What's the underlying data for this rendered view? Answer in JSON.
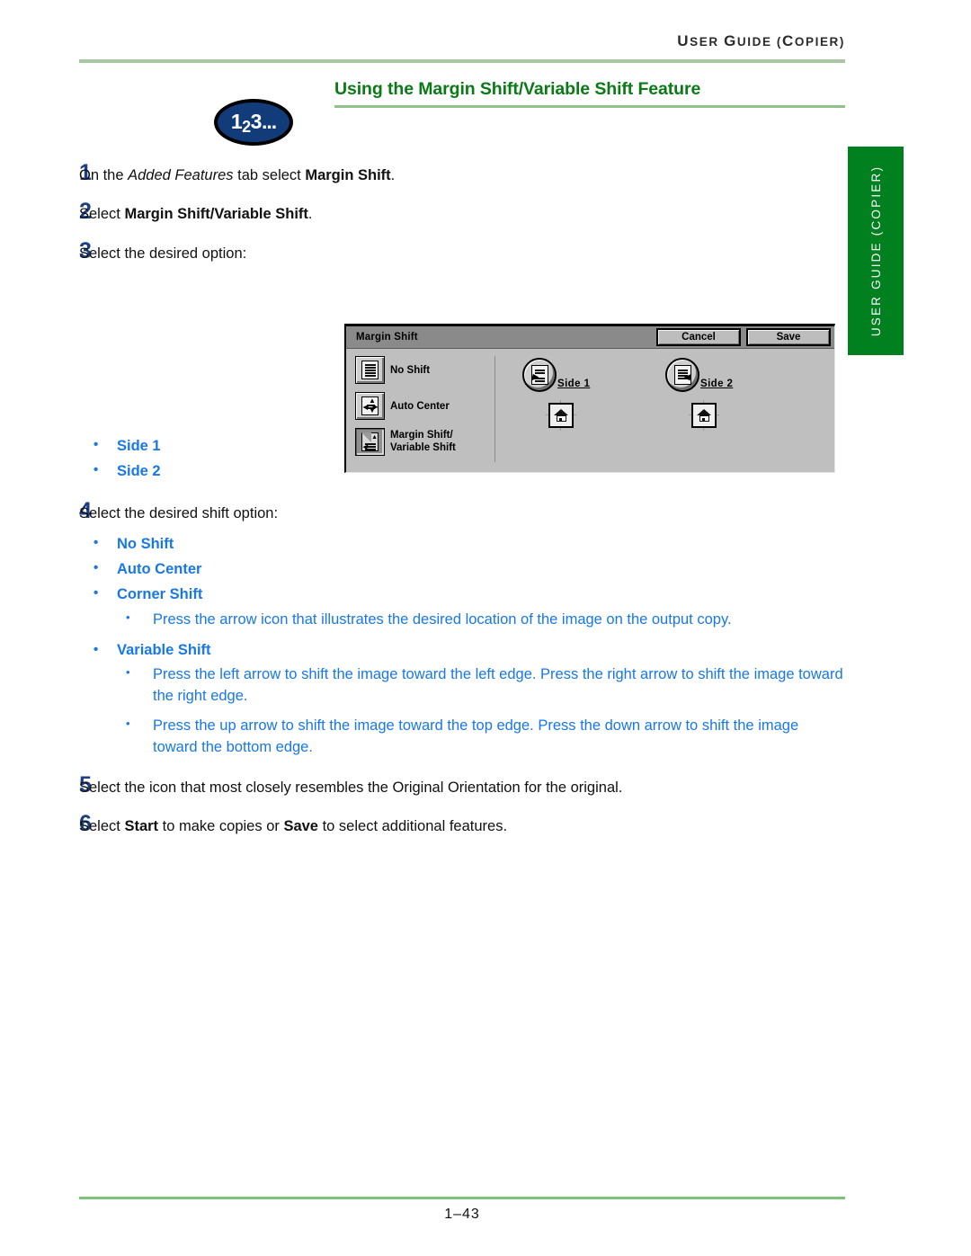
{
  "header": {
    "running_title_prefix": "U",
    "running_title": "USER GUIDE (COPIER)",
    "running_title_parts": [
      "U",
      "SER ",
      "G",
      "UIDE (",
      "C",
      "OPIER)"
    ]
  },
  "side_tab": {
    "label": "USER GUIDE (COPIER)"
  },
  "title": {
    "text": "Using the Margin Shift/Variable Shift Feature",
    "color": "#0a7a16"
  },
  "badge": {
    "digit1": "1",
    "digit2": "2",
    "digit3": "3",
    "dots": "..."
  },
  "steps": [
    {
      "num": "1",
      "text_before": "On the ",
      "italic": "Added Features",
      "text_mid": " tab select ",
      "bold": "Margin Shift",
      "text_after": "."
    },
    {
      "num": "2",
      "text_before": "Select ",
      "bold": "Margin Shift/Variable Shift",
      "text_after": "."
    },
    {
      "num": "3",
      "text": "Select the desired option:"
    },
    {
      "num": "4",
      "text": "Select the desired shift option:"
    },
    {
      "num": "5",
      "text": "Select the icon that most closely resembles the Original Orientation for the original."
    },
    {
      "num": "6",
      "text_before": "Select ",
      "bold": "Start",
      "text_mid": " to make copies or ",
      "bold2": "Save",
      "text_after": " to select additional features."
    }
  ],
  "step3_bullets": [
    "Side 1",
    "Side 2"
  ],
  "step4_bullets": {
    "items": [
      "No Shift",
      "Auto Center",
      "Corner Shift"
    ],
    "corner_shift_detail": "Press the arrow icon that illustrates the desired location of the image on the output copy.",
    "variable_shift_label": "Variable Shift",
    "variable_shift_details": [
      "Press the left arrow to shift the image toward the left edge. Press the right arrow to shift the image toward the right edge.",
      "Press the up arrow to shift the image toward the top edge. Press the down arrow to shift the image toward the bottom edge."
    ]
  },
  "copier_panel": {
    "title": "Margin Shift",
    "cancel_label": "Cancel",
    "save_label": "Save",
    "options": [
      {
        "label": "No Shift",
        "selected": false,
        "icon": "document-lines-icon"
      },
      {
        "label": "Auto Center",
        "selected": false,
        "icon": "auto-center-icon"
      },
      {
        "label_line1": "Margin Shift/",
        "label_line2": "Variable Shift",
        "selected": true,
        "icon": "margin-shift-icon"
      }
    ],
    "sides": [
      {
        "label": "Side 1",
        "icon": "side1-shift-left-icon",
        "orientation_icon": "original-orientation-house-icon"
      },
      {
        "label": "Side 2",
        "icon": "side2-shift-right-icon",
        "orientation_icon": "original-orientation-house-icon"
      }
    ]
  },
  "footer": {
    "page_number": "1–43"
  },
  "colors": {
    "title_green": "#0a7a16",
    "rule_green": "#a9c6a2",
    "tab_green": "#00801e",
    "bullet_blue": "#1878e6",
    "step_number_blue": "#1b3f83",
    "badge_navy": "#123b7a"
  }
}
